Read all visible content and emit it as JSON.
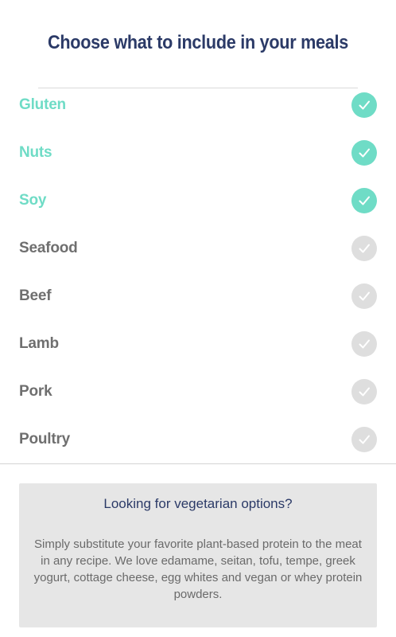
{
  "header": {
    "title": "Choose what to include in your meals"
  },
  "colors": {
    "accent": "#6fdcc6",
    "title": "#2b3a67",
    "inactive_text": "#6f6f6f",
    "inactive_check": "#dedede",
    "card_background": "#e6e6e6"
  },
  "options": {
    "items": [
      {
        "label": "Gluten",
        "selected": true
      },
      {
        "label": "Nuts",
        "selected": true
      },
      {
        "label": "Soy",
        "selected": true
      },
      {
        "label": "Seafood",
        "selected": false
      },
      {
        "label": "Beef",
        "selected": false
      },
      {
        "label": "Lamb",
        "selected": false
      },
      {
        "label": "Pork",
        "selected": false
      },
      {
        "label": "Poultry",
        "selected": false
      }
    ],
    "check_icon": "checkmark-icon"
  },
  "info": {
    "title": "Looking for vegetarian options?",
    "body": "Simply substitute your favorite plant-based protein to the meat in any recipe. We love edamame, seitan, tofu, tempe, greek yogurt, cottage cheese, egg whites and vegan or whey protein powders."
  }
}
